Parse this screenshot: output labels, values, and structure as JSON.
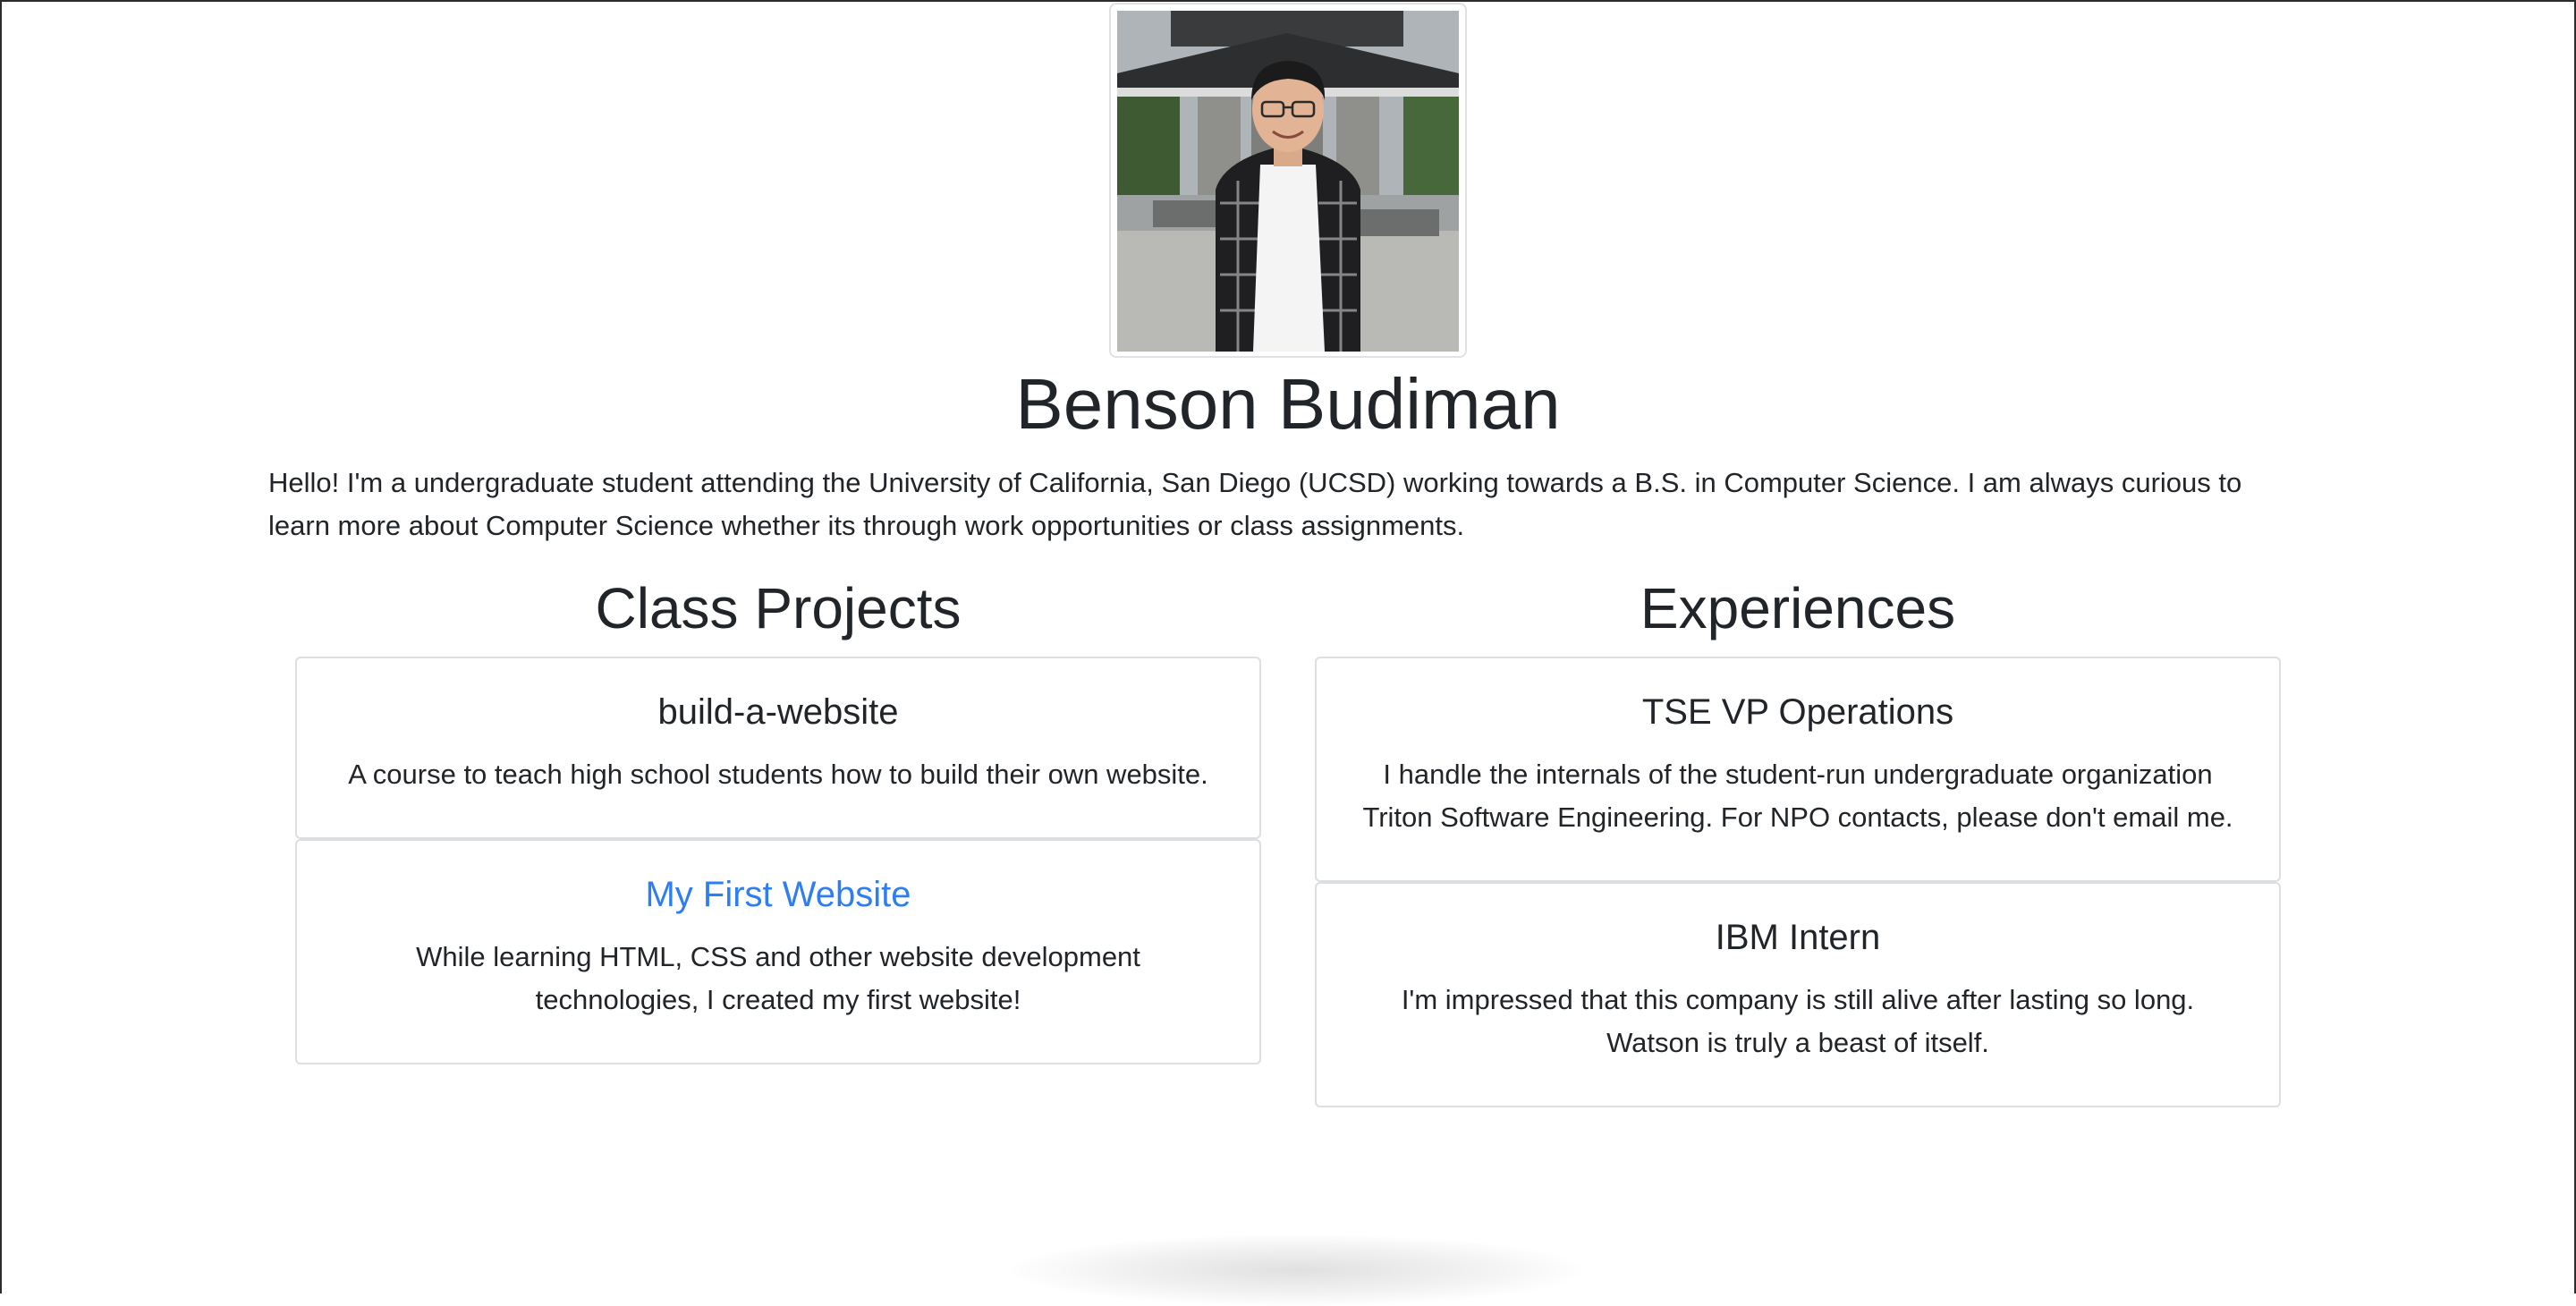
{
  "profile": {
    "photo_alt": "Profile photo",
    "name": "Benson Budiman",
    "bio": "Hello! I'm a undergraduate student attending the University of California, San Diego (UCSD) working towards a B.S. in Computer Science. I am always curious to learn more about Computer Science whether its through work opportunities or class assignments."
  },
  "class_projects": {
    "heading": "Class Projects",
    "items": [
      {
        "title": "build-a-website",
        "text": "A course to teach high school students how to build their own website."
      },
      {
        "title": "My First Website",
        "text": "While learning HTML, CSS and other website development technologies, I created my first website!"
      }
    ]
  },
  "experiences": {
    "heading": "Experiences",
    "items": [
      {
        "title": "TSE VP Operations",
        "text": "I handle the internals of the student-run undergraduate organization Triton Software Engineering. For NPO contacts, please don't email me."
      },
      {
        "title": "IBM Intern",
        "text": "I'm impressed that this company is still alive after lasting so long. Watson is truly a beast of itself."
      }
    ]
  },
  "colors": {
    "text": "#212529",
    "link": "#2f7ef0",
    "card_border": "#dcdfe2"
  }
}
